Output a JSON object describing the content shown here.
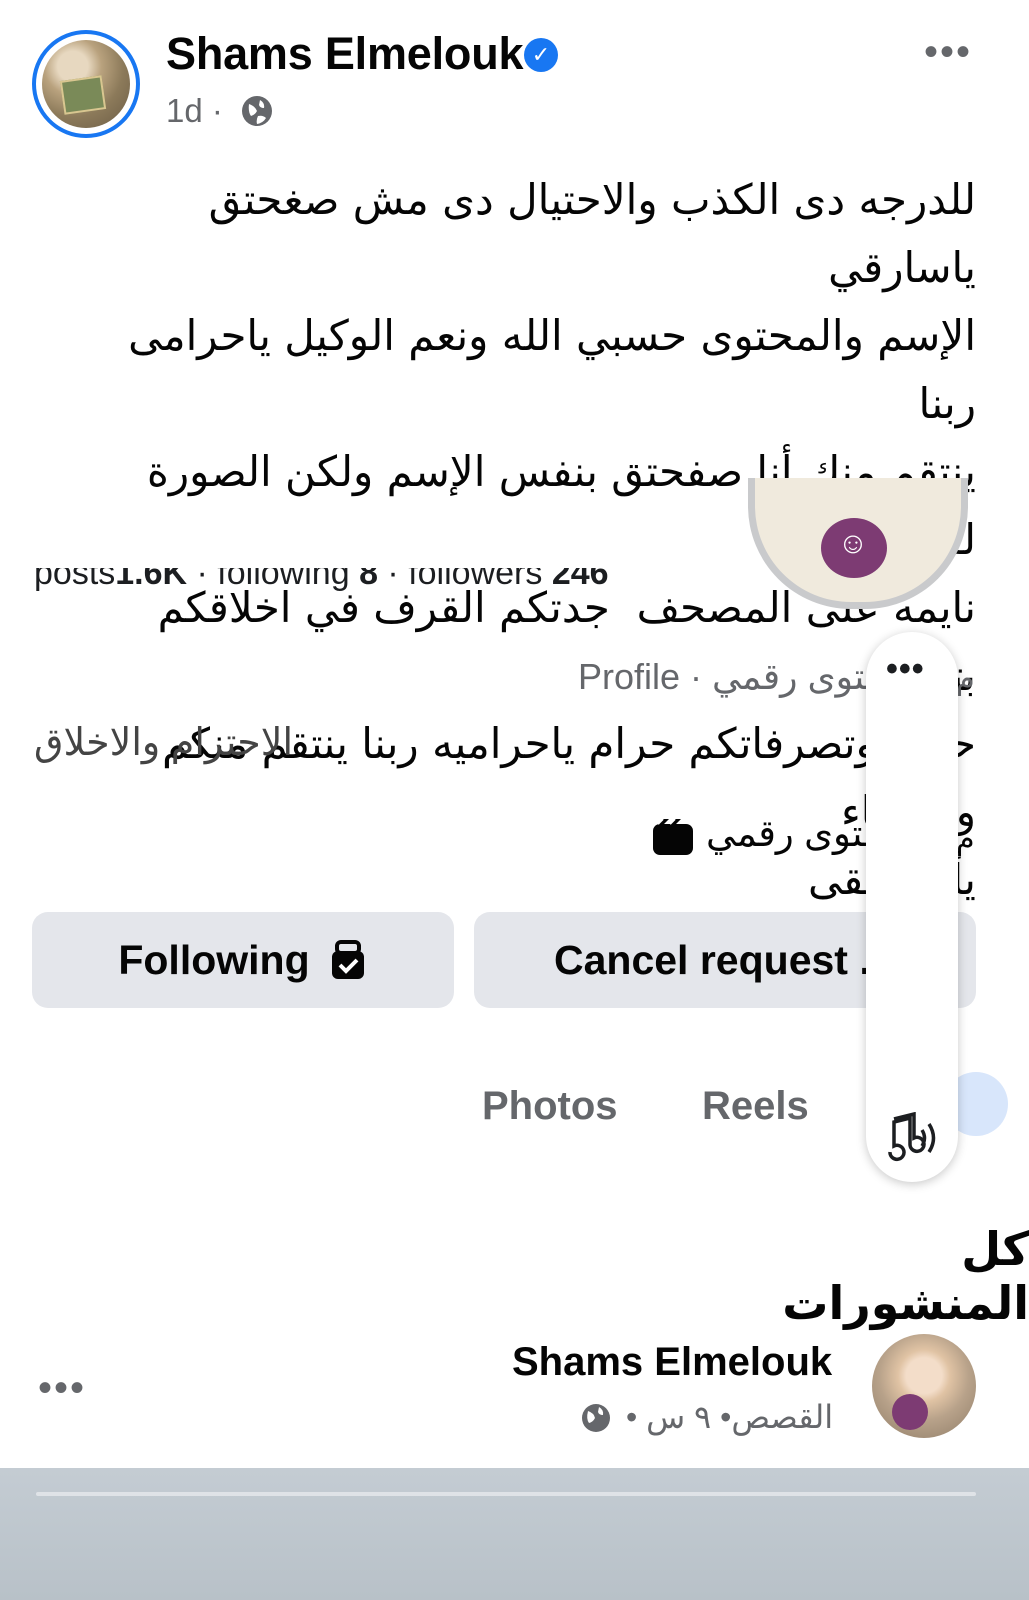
{
  "post": {
    "author": "Shams Elmelouk",
    "time": "1d ·",
    "text": "للدرجه دى الكذب والاحتيال دى مش صغحتق ياسارقي\nالإسم والمحتوى حسبي الله ونعم الوكيل ياحرامى ربنا\nينتقم منك أنا صفحتق بنفس الإسم ولكن الصورة لقطتق\nنايمه على المصحف  جدتكم القرف في اخلاقكم بتاكلوا\nحرام وتصرفاتكم حرام ياحراميه ربنا ينتقم منكم والقضاء\nيأخذ حقى",
    "more_glyph": "•••"
  },
  "screenshot": {
    "stats": {
      "posts_label": "posts",
      "posts_value": "1.6K",
      "following_label": " · following ",
      "following_value": "8",
      "followers_label": " · followers ",
      "followers_value": "246"
    },
    "profile_line": "Profile · حتوى رقمي",
    "trailing_m": "م",
    "bio": "الاحترام والاخلاق",
    "category": "حتوى رقمي",
    "buttons": {
      "following": "Following",
      "cancel": "Cancel request ."
    },
    "tabs": [
      "Photos",
      "Reels"
    ],
    "pill_more": "•••",
    "section_title": "كل المنشورات",
    "mini_post": {
      "author": "Shams Elmelouk",
      "meta": "القصص• ٩ س •"
    },
    "more_glyph": "•••"
  },
  "colors": {
    "accent": "#1877f2",
    "button_bg": "#e4e6eb",
    "secondary_text": "#65676b",
    "brand_purple": "#7d3b73"
  }
}
